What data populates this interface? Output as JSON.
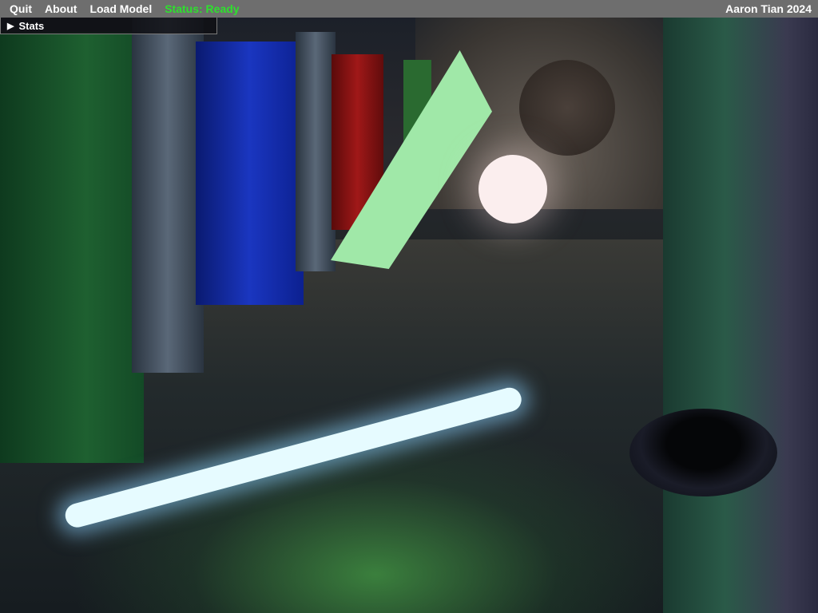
{
  "menubar": {
    "items": [
      "Quit",
      "About",
      "Load Model"
    ],
    "status": "Status: Ready",
    "author": "Aaron Tian 2024"
  },
  "stats_window": {
    "title": "Stats",
    "collapsed": true
  },
  "colors": {
    "menubar": "#6e6e6e",
    "status": "#2ee02e",
    "quad": "#a0e8a8",
    "sphere": "#fbeeee",
    "tube": "#e6fbff"
  }
}
